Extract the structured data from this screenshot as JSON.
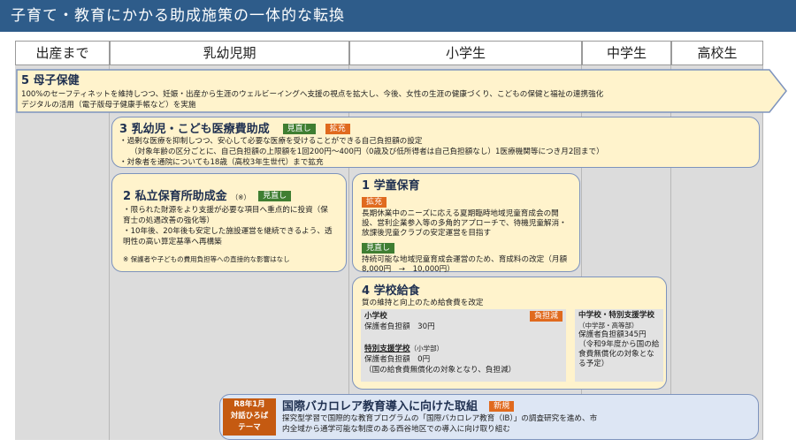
{
  "title": "子育て・教育にかかる助成施策の一体的な転換",
  "columns": [
    "出産まで",
    "乳幼児期",
    "小学生",
    "中学生",
    "高校生"
  ],
  "boxes": {
    "boshi": {
      "title": "5 母子保健",
      "lines": [
        "100%のセーフティネットを維持しつつ、妊娠・出産から生涯のウェルビーイングへ支援の視点を拡大し、今後、女性の生涯の健康づくり、こどもの保健と福祉の連携強化",
        "デジタルの活用（電子版母子健康手帳など）を実施"
      ]
    },
    "iryo": {
      "title": "3 乳幼児・こども医療費助成",
      "tags": [
        "見直し",
        "拡充"
      ],
      "lines": [
        "・過剰な医療を抑制しつつ、安心して必要な医療を受けることができる自己負担額の設定",
        "（対象年齢の区分ごとに、自己負担額の上限額を1回200円～400円（0歳及び低所得者は自己負担額なし）1医療機関等につき月2回まで）",
        "・対象者を通院についても18歳（高校3年生世代）まで拡充"
      ]
    },
    "hoiku": {
      "title": "2 私立保育所助成金",
      "mark": "（※）",
      "tag": "見直し",
      "lines": [
        "・限られた財源をより支援が必要な項目へ重点的に投資（保育士の処遇改善の強化等）",
        "・10年後、20年後も安定した施設運営を継続できるよう、透明性の高い算定基準へ再構築"
      ],
      "note": "※ 保護者や子どもの費用負担等への直接的な影響はなし"
    },
    "gakudo": {
      "title": "1 学童保育",
      "tag1": "拡充",
      "text1": "長期休業中のニーズに応える夏期臨時地域児童育成会の開設、営利企業参入等の多角的アプローチで、待機児童解消・放課後児童クラブの安定運営を目指す",
      "tag2": "見直し",
      "text2": "持続可能な地域児童育成会運営のため、育成料の改定（月額8,000円　→　10,000円）"
    },
    "kyushoku": {
      "title": "4 学校給食",
      "subtitle": "質の維持と向上のため給食費を改定",
      "es_label": "小学校",
      "es_tag": "負担減",
      "es_text": "保護者負担額　30円",
      "sp_label": "特別支援学校",
      "sp_small": "（小学部）",
      "sp_text1": "保護者負担額　0円",
      "sp_text2": "（国の給食費無償化の対象となり、負担減）",
      "jh_label": "中学校・特別支援学校",
      "jh_small": "（中学部・高等部）",
      "jh_text": "保護者負担額345円（令和9年度から国の給食費無償化の対象となる予定）"
    },
    "ib": {
      "badge": "R8年1月\n対話ひろば\nテーマ",
      "title": "国際バカロレア教育導入に向けた取組",
      "tag": "新規",
      "lines": [
        "探究型学習で国際的な教育プログラムの「国際バカロレア教育（IB）」の調査研究を進め、市",
        "内全域から通学可能な制度のある西谷地区での導入に向け取り組む"
      ]
    }
  },
  "colors": {
    "title_bg": "#2e5c8a",
    "box_bg": "#fff3cc",
    "box_border": "#7d93bd",
    "tag_green": "#3f7e32",
    "tag_orange": "#e06a1e",
    "ib_bg": "#dde6f4",
    "badge_bg": "#c55a11"
  }
}
